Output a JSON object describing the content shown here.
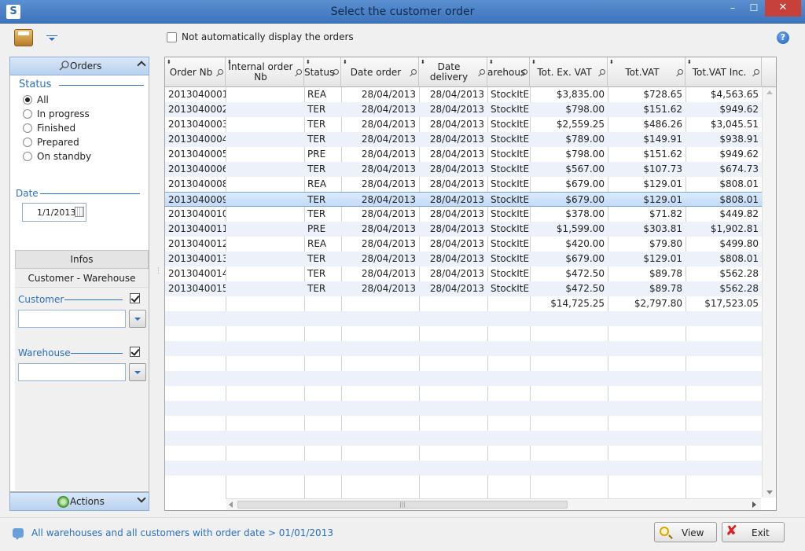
{
  "window": {
    "title": "Select the customer order",
    "app_icon": "S",
    "minimize": "–",
    "maximize": "☐",
    "close": "✕"
  },
  "toolbar": {
    "auto_display_label": "Not automatically display the orders",
    "help_icon": "?"
  },
  "left_panel": {
    "header": "Orders",
    "status_title": "Status",
    "status_options": [
      "All",
      "In progress",
      "Finished",
      "Prepared",
      "On standby"
    ],
    "date_title": "Date",
    "date_value": "1/1/2013",
    "infos_tab": "Infos",
    "infos_subtab": "Customer - Warehouse",
    "customer_label": "Customer",
    "warehouse_label": "Warehouse",
    "footer": "Actions"
  },
  "grid": {
    "columns": [
      {
        "label": "Order Nb"
      },
      {
        "label": "Internal order Nb"
      },
      {
        "label": "Status"
      },
      {
        "label": "Date order"
      },
      {
        "label": "Date delivery"
      },
      {
        "label": "arehous"
      },
      {
        "label": "Tot. Ex. VAT"
      },
      {
        "label": "Tot.VAT"
      },
      {
        "label": "Tot.VAT Inc."
      }
    ],
    "rows": [
      [
        "2013040001",
        "",
        "REA",
        "28/04/2013",
        "28/04/2013",
        "StockItE",
        "$3,835.00",
        "$728.65",
        "$4,563.65"
      ],
      [
        "2013040002",
        "",
        "TER",
        "28/04/2013",
        "28/04/2013",
        "StockItE",
        "$798.00",
        "$151.62",
        "$949.62"
      ],
      [
        "2013040003",
        "",
        "TER",
        "28/04/2013",
        "28/04/2013",
        "StockItE",
        "$2,559.25",
        "$486.26",
        "$3,045.51"
      ],
      [
        "2013040004",
        "",
        "TER",
        "28/04/2013",
        "28/04/2013",
        "StockItE",
        "$789.00",
        "$149.91",
        "$938.91"
      ],
      [
        "2013040005",
        "",
        "PRE",
        "28/04/2013",
        "28/04/2013",
        "StockItE",
        "$798.00",
        "$151.62",
        "$949.62"
      ],
      [
        "2013040006",
        "",
        "TER",
        "28/04/2013",
        "28/04/2013",
        "StockItE",
        "$567.00",
        "$107.73",
        "$674.73"
      ],
      [
        "2013040008",
        "",
        "REA",
        "28/04/2013",
        "28/04/2013",
        "StockItE",
        "$679.00",
        "$129.01",
        "$808.01"
      ],
      [
        "2013040009",
        "",
        "TER",
        "28/04/2013",
        "28/04/2013",
        "StockItE",
        "$679.00",
        "$129.01",
        "$808.01"
      ],
      [
        "2013040010",
        "",
        "TER",
        "28/04/2013",
        "28/04/2013",
        "StockItE",
        "$378.00",
        "$71.82",
        "$449.82"
      ],
      [
        "2013040011",
        "",
        "PRE",
        "28/04/2013",
        "28/04/2013",
        "StockItE",
        "$1,599.00",
        "$303.81",
        "$1,902.81"
      ],
      [
        "2013040012",
        "",
        "REA",
        "28/04/2013",
        "28/04/2013",
        "StockItE",
        "$420.00",
        "$79.80",
        "$499.80"
      ],
      [
        "2013040013",
        "",
        "TER",
        "28/04/2013",
        "28/04/2013",
        "StockItE",
        "$679.00",
        "$129.01",
        "$808.01"
      ],
      [
        "2013040014",
        "",
        "TER",
        "28/04/2013",
        "28/04/2013",
        "StockItE",
        "$472.50",
        "$89.78",
        "$562.28"
      ],
      [
        "2013040015",
        "",
        "TER",
        "28/04/2013",
        "28/04/2013",
        "StockItE",
        "$472.50",
        "$89.78",
        "$562.28"
      ]
    ],
    "selected_row": 7,
    "totals": [
      "",
      "",
      "",
      "",
      "",
      "",
      "$14,725.25",
      "$2,797.80",
      "$17,523.05"
    ]
  },
  "statusbar": {
    "text": "All warehouses and all customers with order date > 01/01/2013",
    "view_label": "View",
    "exit_label": "Exit"
  },
  "colors": {
    "accent": "#2a6fc0",
    "titlebar": "#4a80c6",
    "selected_row": "#c9e0f8"
  }
}
